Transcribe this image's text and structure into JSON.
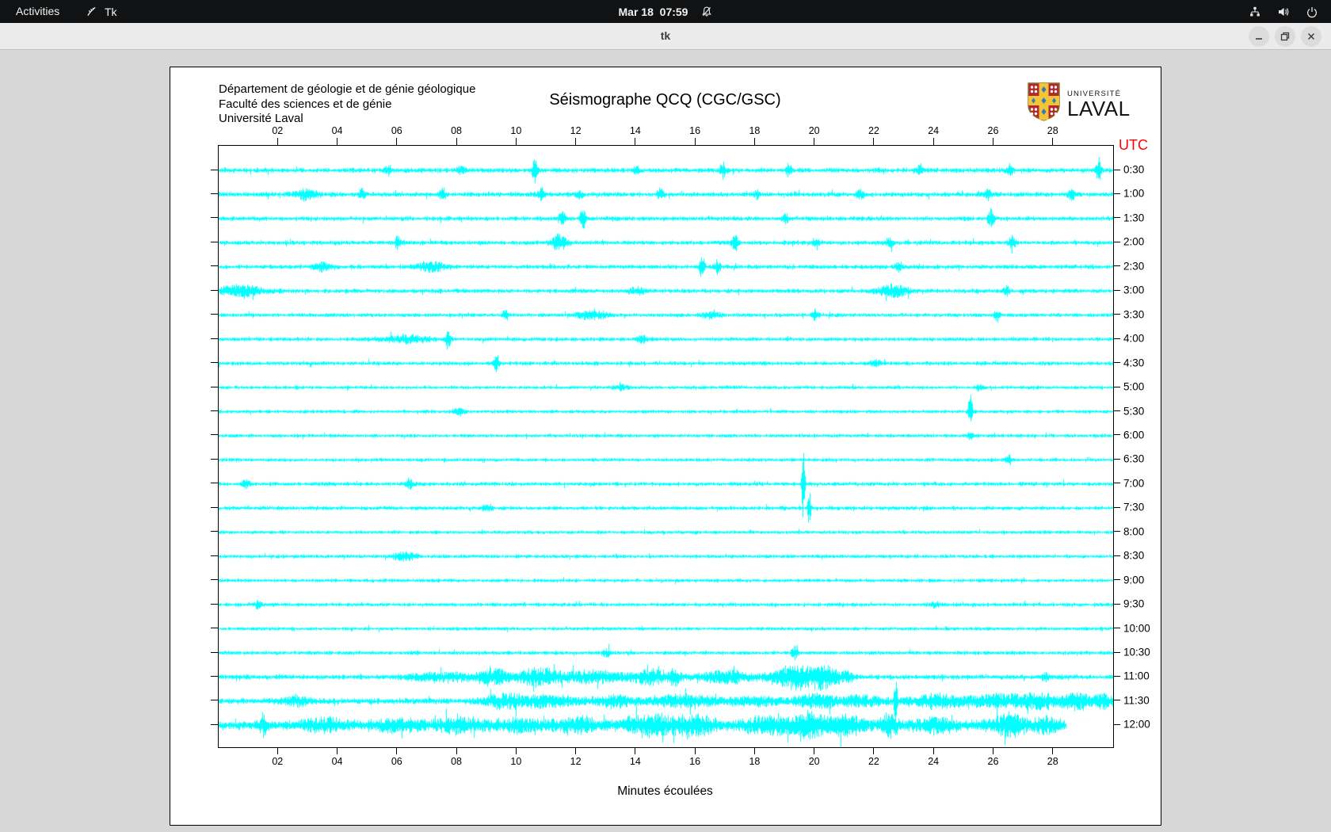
{
  "top_bar": {
    "activities": "Activities",
    "app_name": "Tk",
    "app_icon": "tk-feather-icon",
    "clock": "Mar 18  07:59",
    "clock_icon": "notifications-muted-icon",
    "status_icons": [
      "network-icon",
      "volume-icon",
      "power-icon"
    ]
  },
  "titlebar": {
    "title": "tk",
    "buttons": {
      "minimize": "minimize",
      "restore": "restore",
      "close": "close"
    }
  },
  "seismograph": {
    "institution_lines": [
      "Département de géologie et de génie géologique",
      "Faculté des sciences et de génie",
      "Université Laval"
    ],
    "title": "Séismographe QCQ (CGC/GSC)",
    "utc_label": "UTC",
    "xlabel": "Minutes écoulées",
    "logo": {
      "small_text": "UNIVERSITÉ",
      "large_text": "LAVAL"
    },
    "colors": {
      "trace": "#00ffff",
      "utc": "#ff0000",
      "axis": "#000000"
    },
    "chart_data": {
      "type": "line",
      "description": "24 half-hour seismogram traces, UTC 0:30 to 12:00, 30 minutes per line",
      "x_range": [
        0,
        30
      ],
      "x_tick_minutes": [
        2,
        4,
        6,
        8,
        10,
        12,
        14,
        16,
        18,
        20,
        22,
        24,
        26,
        28
      ],
      "x_tick_labels": [
        "02",
        "04",
        "06",
        "08",
        "10",
        "12",
        "14",
        "16",
        "18",
        "20",
        "22",
        "24",
        "26",
        "28"
      ],
      "rows": [
        {
          "label": "0:30",
          "base": 2.2,
          "events": [
            [
              5.7,
              5,
              0.12
            ],
            [
              8.1,
              4,
              0.12
            ],
            [
              10.6,
              11,
              0.1
            ],
            [
              14.0,
              4,
              0.12
            ],
            [
              16.9,
              8,
              0.1
            ],
            [
              19.1,
              6,
              0.1
            ],
            [
              23.5,
              4,
              0.12
            ],
            [
              26.5,
              5,
              0.12
            ],
            [
              29.5,
              13,
              0.08
            ]
          ]
        },
        {
          "label": "1:00",
          "base": 2.2,
          "events": [
            [
              2.9,
              5,
              0.35
            ],
            [
              4.8,
              5,
              0.12
            ],
            [
              7.5,
              6,
              0.1
            ],
            [
              10.8,
              5,
              0.12
            ],
            [
              12.1,
              4,
              0.12
            ],
            [
              14.8,
              5,
              0.12
            ],
            [
              18.0,
              4,
              0.12
            ],
            [
              21.5,
              4,
              0.12
            ],
            [
              25.8,
              6,
              0.1
            ],
            [
              28.6,
              5,
              0.12
            ]
          ]
        },
        {
          "label": "1:30",
          "base": 2.0,
          "events": [
            [
              11.5,
              7,
              0.12
            ],
            [
              12.2,
              12,
              0.08
            ],
            [
              19.0,
              4,
              0.12
            ],
            [
              25.9,
              9,
              0.1
            ]
          ]
        },
        {
          "label": "2:00",
          "base": 2.0,
          "events": [
            [
              6.0,
              7,
              0.1
            ],
            [
              11.4,
              8,
              0.25
            ],
            [
              17.3,
              9,
              0.1
            ],
            [
              20.0,
              4,
              0.12
            ],
            [
              22.5,
              5,
              0.12
            ],
            [
              26.6,
              8,
              0.1
            ]
          ]
        },
        {
          "label": "2:30",
          "base": 2.0,
          "events": [
            [
              3.5,
              4,
              0.3
            ],
            [
              7.1,
              5,
              0.5
            ],
            [
              16.2,
              11,
              0.1
            ],
            [
              16.7,
              7,
              0.1
            ],
            [
              22.8,
              4,
              0.12
            ]
          ]
        },
        {
          "label": "3:00",
          "base": 2.0,
          "events": [
            [
              0.7,
              5,
              0.8
            ],
            [
              14.0,
              3,
              0.3
            ],
            [
              22.6,
              6,
              0.5
            ],
            [
              26.4,
              5,
              0.1
            ]
          ]
        },
        {
          "label": "3:30",
          "base": 1.8,
          "events": [
            [
              9.6,
              6,
              0.1
            ],
            [
              12.5,
              4,
              0.5
            ],
            [
              16.5,
              3,
              0.3
            ],
            [
              20.0,
              6,
              0.1
            ],
            [
              26.1,
              6,
              0.1
            ]
          ]
        },
        {
          "label": "4:00",
          "base": 1.8,
          "events": [
            [
              6.3,
              4,
              0.7
            ],
            [
              7.7,
              8,
              0.1
            ],
            [
              14.2,
              3,
              0.2
            ]
          ]
        },
        {
          "label": "4:30",
          "base": 1.8,
          "events": [
            [
              9.3,
              9,
              0.1
            ],
            [
              22.0,
              3,
              0.2
            ]
          ]
        },
        {
          "label": "5:00",
          "base": 1.6,
          "events": [
            [
              13.5,
              3,
              0.2
            ],
            [
              25.5,
              4,
              0.12
            ]
          ]
        },
        {
          "label": "5:30",
          "base": 1.6,
          "events": [
            [
              8.0,
              3,
              0.2
            ],
            [
              25.2,
              19,
              0.07
            ]
          ]
        },
        {
          "label": "6:00",
          "base": 1.6,
          "events": [
            [
              25.2,
              4,
              0.1
            ]
          ]
        },
        {
          "label": "6:30",
          "base": 1.6,
          "events": [
            [
              26.5,
              5,
              0.1
            ]
          ]
        },
        {
          "label": "7:00",
          "base": 1.8,
          "events": [
            [
              0.9,
              4,
              0.15
            ],
            [
              6.4,
              4,
              0.15
            ],
            [
              19.6,
              42,
              0.05
            ]
          ]
        },
        {
          "label": "7:30",
          "base": 1.8,
          "events": [
            [
              9.0,
              4,
              0.15
            ],
            [
              19.8,
              22,
              0.05
            ]
          ]
        },
        {
          "label": "8:00",
          "base": 1.6,
          "events": []
        },
        {
          "label": "8:30",
          "base": 1.7,
          "events": [
            [
              6.2,
              4,
              0.4
            ]
          ]
        },
        {
          "label": "9:00",
          "base": 1.6,
          "events": []
        },
        {
          "label": "9:30",
          "base": 1.7,
          "events": [
            [
              1.3,
              4,
              0.12
            ],
            [
              24.0,
              3,
              0.15
            ]
          ]
        },
        {
          "label": "10:00",
          "base": 1.6,
          "events": []
        },
        {
          "label": "10:30",
          "base": 1.8,
          "events": [
            [
              13.0,
              4,
              0.12
            ],
            [
              19.3,
              7,
              0.1
            ]
          ]
        },
        {
          "label": "11:00",
          "base": 2.2,
          "events": [
            [
              7.5,
              4,
              1.2
            ],
            [
              9.2,
              8,
              0.5
            ],
            [
              10.7,
              9,
              0.7
            ],
            [
              12.5,
              6,
              1.0
            ],
            [
              14.5,
              7,
              0.7
            ],
            [
              15.3,
              8,
              0.15
            ],
            [
              17.0,
              6,
              0.9
            ],
            [
              19.3,
              13,
              0.7
            ],
            [
              20.3,
              11,
              0.4
            ],
            [
              21.0,
              5,
              0.3
            ],
            [
              27.7,
              4,
              0.12
            ]
          ]
        },
        {
          "label": "11:30",
          "base": 2.6,
          "events": [
            [
              2.6,
              4,
              0.5
            ],
            [
              9.5,
              6,
              0.7
            ],
            [
              11.0,
              5,
              1.0
            ],
            [
              13.2,
              5,
              0.7
            ],
            [
              15.5,
              5,
              1.2
            ],
            [
              18.0,
              4,
              0.9
            ],
            [
              20.0,
              6,
              0.7
            ],
            [
              21.5,
              5,
              0.7
            ],
            [
              22.7,
              28,
              0.05
            ],
            [
              24.0,
              6,
              1.0
            ],
            [
              26.0,
              6,
              0.9
            ],
            [
              27.5,
              7,
              0.7
            ],
            [
              28.8,
              8,
              0.5
            ],
            [
              29.7,
              6,
              0.3
            ]
          ]
        },
        {
          "label": "12:00",
          "base": 4.2,
          "end": 28.4,
          "events": [
            [
              1.5,
              12,
              0.08
            ],
            [
              3.5,
              5,
              0.7
            ],
            [
              6.0,
              5,
              0.9
            ],
            [
              8.0,
              6,
              0.7
            ],
            [
              10.0,
              5,
              0.9
            ],
            [
              12.0,
              6,
              0.7
            ],
            [
              14.5,
              9,
              0.9
            ],
            [
              16.0,
              7,
              0.7
            ],
            [
              18.5,
              8,
              0.9
            ],
            [
              19.8,
              11,
              0.5
            ],
            [
              21.0,
              9,
              0.7
            ],
            [
              22.5,
              11,
              0.25
            ],
            [
              24.0,
              6,
              0.7
            ],
            [
              26.5,
              9,
              0.7
            ],
            [
              27.8,
              7,
              0.35
            ]
          ]
        }
      ]
    }
  }
}
